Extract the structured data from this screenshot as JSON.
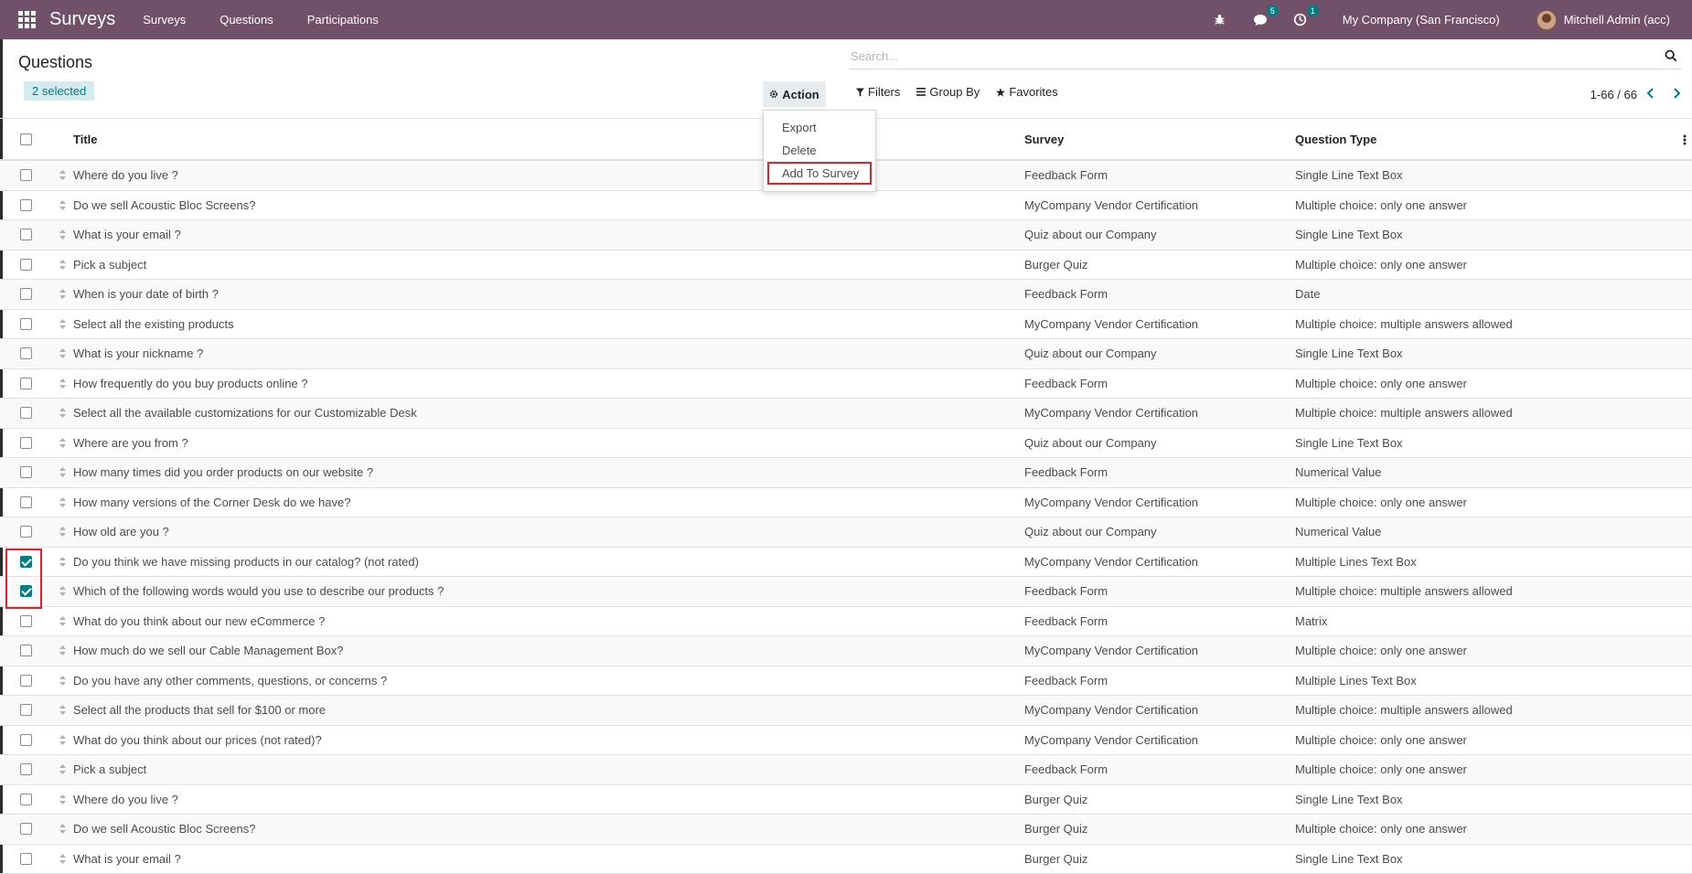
{
  "topbar": {
    "brand": "Surveys",
    "nav": [
      "Surveys",
      "Questions",
      "Participations"
    ],
    "messages_count": "5",
    "activity_count": "1",
    "company": "My Company (San Francisco)",
    "user": "Mitchell Admin (acc)",
    "color": "#71506a"
  },
  "control": {
    "title": "Questions",
    "selected": "2 selected",
    "action_label": "Action",
    "search_placeholder": "Search...",
    "filters_label": "Filters",
    "groupby_label": "Group By",
    "favorites_label": "Favorites",
    "pager": "1-66 / 66"
  },
  "action_menu": {
    "export": "Export",
    "delete": "Delete",
    "add_to_survey": "Add To Survey"
  },
  "table": {
    "headers": {
      "title": "Title",
      "survey": "Survey",
      "type": "Question Type"
    },
    "rows": [
      {
        "title": "Where do you live ?",
        "survey": "Feedback Form",
        "type": "Single Line Text Box",
        "checked": false
      },
      {
        "title": "Do we sell Acoustic Bloc Screens?",
        "survey": "MyCompany Vendor Certification",
        "type": "Multiple choice: only one answer",
        "checked": false
      },
      {
        "title": "What is your email ?",
        "survey": "Quiz about our Company",
        "type": "Single Line Text Box",
        "checked": false
      },
      {
        "title": "Pick a subject",
        "survey": "Burger Quiz",
        "type": "Multiple choice: only one answer",
        "checked": false
      },
      {
        "title": "When is your date of birth ?",
        "survey": "Feedback Form",
        "type": "Date",
        "checked": false
      },
      {
        "title": "Select all the existing products",
        "survey": "MyCompany Vendor Certification",
        "type": "Multiple choice: multiple answers allowed",
        "checked": false
      },
      {
        "title": "What is your nickname ?",
        "survey": "Quiz about our Company",
        "type": "Single Line Text Box",
        "checked": false
      },
      {
        "title": "How frequently do you buy products online ?",
        "survey": "Feedback Form",
        "type": "Multiple choice: only one answer",
        "checked": false
      },
      {
        "title": "Select all the available customizations for our Customizable Desk",
        "survey": "MyCompany Vendor Certification",
        "type": "Multiple choice: multiple answers allowed",
        "checked": false
      },
      {
        "title": "Where are you from ?",
        "survey": "Quiz about our Company",
        "type": "Single Line Text Box",
        "checked": false
      },
      {
        "title": "How many times did you order products on our website ?",
        "survey": "Feedback Form",
        "type": "Numerical Value",
        "checked": false
      },
      {
        "title": "How many versions of the Corner Desk do we have?",
        "survey": "MyCompany Vendor Certification",
        "type": "Multiple choice: only one answer",
        "checked": false
      },
      {
        "title": "How old are you ?",
        "survey": "Quiz about our Company",
        "type": "Numerical Value",
        "checked": false
      },
      {
        "title": "Do you think we have missing products in our catalog? (not rated)",
        "survey": "MyCompany Vendor Certification",
        "type": "Multiple Lines Text Box",
        "checked": true
      },
      {
        "title": "Which of the following words would you use to describe our products ?",
        "survey": "Feedback Form",
        "type": "Multiple choice: multiple answers allowed",
        "checked": true
      },
      {
        "title": "What do you think about our new eCommerce ?",
        "survey": "Feedback Form",
        "type": "Matrix",
        "checked": false
      },
      {
        "title": "How much do we sell our Cable Management Box?",
        "survey": "MyCompany Vendor Certification",
        "type": "Multiple choice: only one answer",
        "checked": false
      },
      {
        "title": "Do you have any other comments, questions, or concerns ?",
        "survey": "Feedback Form",
        "type": "Multiple Lines Text Box",
        "checked": false
      },
      {
        "title": "Select all the products that sell for $100 or more",
        "survey": "MyCompany Vendor Certification",
        "type": "Multiple choice: multiple answers allowed",
        "checked": false
      },
      {
        "title": "What do you think about our prices (not rated)?",
        "survey": "MyCompany Vendor Certification",
        "type": "Multiple choice: only one answer",
        "checked": false
      },
      {
        "title": "Pick a subject",
        "survey": "Feedback Form",
        "type": "Multiple choice: only one answer",
        "checked": false
      },
      {
        "title": "Where do you live ?",
        "survey": "Burger Quiz",
        "type": "Single Line Text Box",
        "checked": false
      },
      {
        "title": "Do we sell Acoustic Bloc Screens?",
        "survey": "Burger Quiz",
        "type": "Multiple choice: only one answer",
        "checked": false
      },
      {
        "title": "What is your email ?",
        "survey": "Burger Quiz",
        "type": "Single Line Text Box",
        "checked": false
      }
    ]
  }
}
